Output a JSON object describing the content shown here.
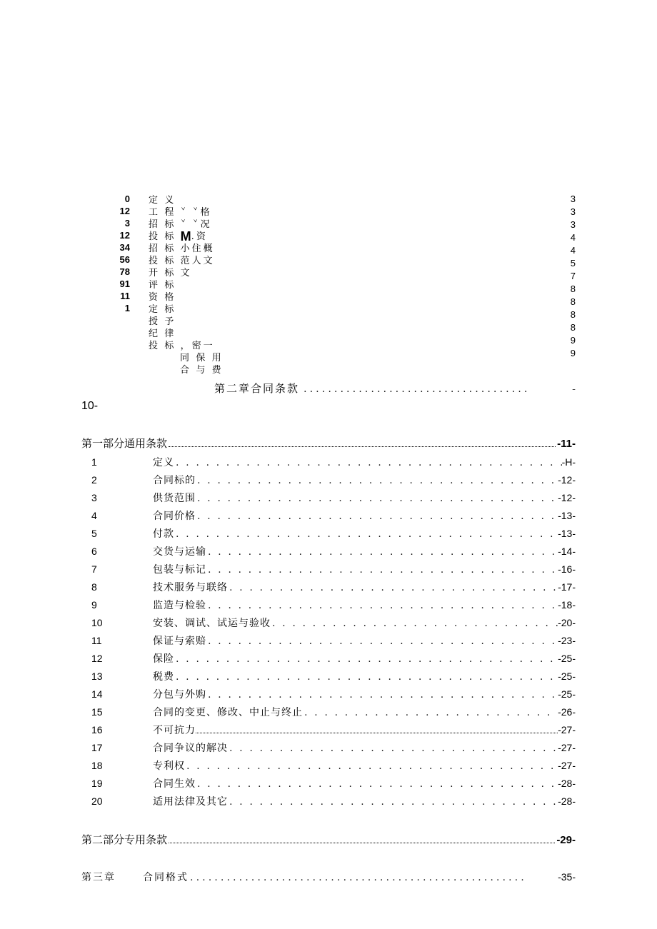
{
  "top": {
    "left_nums": [
      "0",
      "12",
      "3",
      "12",
      "34",
      "56",
      "78",
      "91",
      "11",
      "1"
    ],
    "mid_lines": [
      {
        "t": "定 义",
        "sub": false
      },
      {
        "t": "工 程 ˇ ˇ格",
        "sub": false
      },
      {
        "t": "招 标 ˇ ˇ况",
        "sub": false
      },
      {
        "t": "投 标 <M>M</M>.资",
        "sub": false
      },
      {
        "t": "招 标 小住概",
        "sub": false
      },
      {
        "t": "投 标 范人文",
        "sub": false
      },
      {
        "t": "开 标 文",
        "sub": false
      },
      {
        "t": "评 标",
        "sub": false
      },
      {
        "t": "资 格",
        "sub": false
      },
      {
        "t": "定 标",
        "sub": false
      },
      {
        "t": "授 予",
        "sub": false
      },
      {
        "t": "纪 律",
        "sub": false
      },
      {
        "t": "投 标 ，密一",
        "sub": false
      },
      {
        "t": "同 保 用",
        "sub": true
      },
      {
        "t": "合 与 费",
        "sub": true
      }
    ],
    "right_nums": [
      "3",
      "3",
      "3",
      "4",
      "4",
      "5",
      "7",
      "8",
      "8",
      "8",
      "8",
      "9",
      "9"
    ]
  },
  "chapter2": {
    "title": "第二章合同条款",
    "trail": "-",
    "sub": "10-"
  },
  "part1_header": {
    "label": "第一部分通用条款",
    "page": "-11-"
  },
  "part2_header": {
    "label": "第二部分专用条款",
    "page": "-29-"
  },
  "toc": [
    {
      "num": "1",
      "title": "定义",
      "page": "-H-",
      "style": "dot"
    },
    {
      "num": "2",
      "title": "合同标的",
      "page": "-12-",
      "style": "dot"
    },
    {
      "num": "3",
      "title": "供货范围",
      "page": "-12-",
      "style": "dot"
    },
    {
      "num": "4",
      "title": "合同价格",
      "page": "-13-",
      "style": "dot"
    },
    {
      "num": "5",
      "title": "付款",
      "page": "-13-",
      "style": "dot"
    },
    {
      "num": "6",
      "title": "交货与运输",
      "page": "-14-",
      "style": "dot"
    },
    {
      "num": "7",
      "title": "包装与标记",
      "page": "-16-",
      "style": "dot"
    },
    {
      "num": "8",
      "title": "技术服务与联络",
      "page": "-17-",
      "style": "dot"
    },
    {
      "num": "9",
      "title": "监造与检验",
      "page": "-18-",
      "style": "dot"
    },
    {
      "num": "10",
      "title": "安装、调试、试运与验收",
      "page": "-20-",
      "style": "dot"
    },
    {
      "num": "11",
      "title": "保证与索赔",
      "page": "-23-",
      "style": "dot"
    },
    {
      "num": "12",
      "title": "保险",
      "page": "-25-",
      "style": "dot"
    },
    {
      "num": "13",
      "title": "税费",
      "page": "-25-",
      "style": "dot"
    },
    {
      "num": "14",
      "title": "分包与外购",
      "page": "-25-",
      "style": "dot"
    },
    {
      "num": "15",
      "title": "合同的变更、修改、中止与终止",
      "page": "-26-",
      "style": "dot"
    },
    {
      "num": "16",
      "title": "不可抗力",
      "page": "-27-",
      "style": "fine"
    },
    {
      "num": "17",
      "title": "合同争议的解决",
      "page": "-27-",
      "style": "dot"
    },
    {
      "num": "18",
      "title": "专利权",
      "page": "-27-",
      "style": "dot"
    },
    {
      "num": "19",
      "title": "合同生效",
      "page": "-28-",
      "style": "dot"
    },
    {
      "num": "20",
      "title": "适用法律及其它",
      "page": "-28-",
      "style": "dot"
    }
  ],
  "chapter3": {
    "chap": "第三章",
    "title": "合同格式",
    "page": "-35-"
  },
  "dot_run": ". . . . . . . . . . . . . . . . . . . . . . . . . . . . . . . . . . . . . . . . . . . . . . . . . . . . . . . . . . . . . . . . . . . . . . . . . . . . . . . . . . . . . . . . . . . . . . . . . . . . . . . . . . . . . . . . . . . . . . . . . . . . . . . . . . . . . . . . . . . . . . . . . . . . . . . . . . . . . . . . . . . . . . . . . . . . . . . . . . . .",
  "wide_dot_run": ".....................................",
  "ch3_dot_run": "......................................................."
}
